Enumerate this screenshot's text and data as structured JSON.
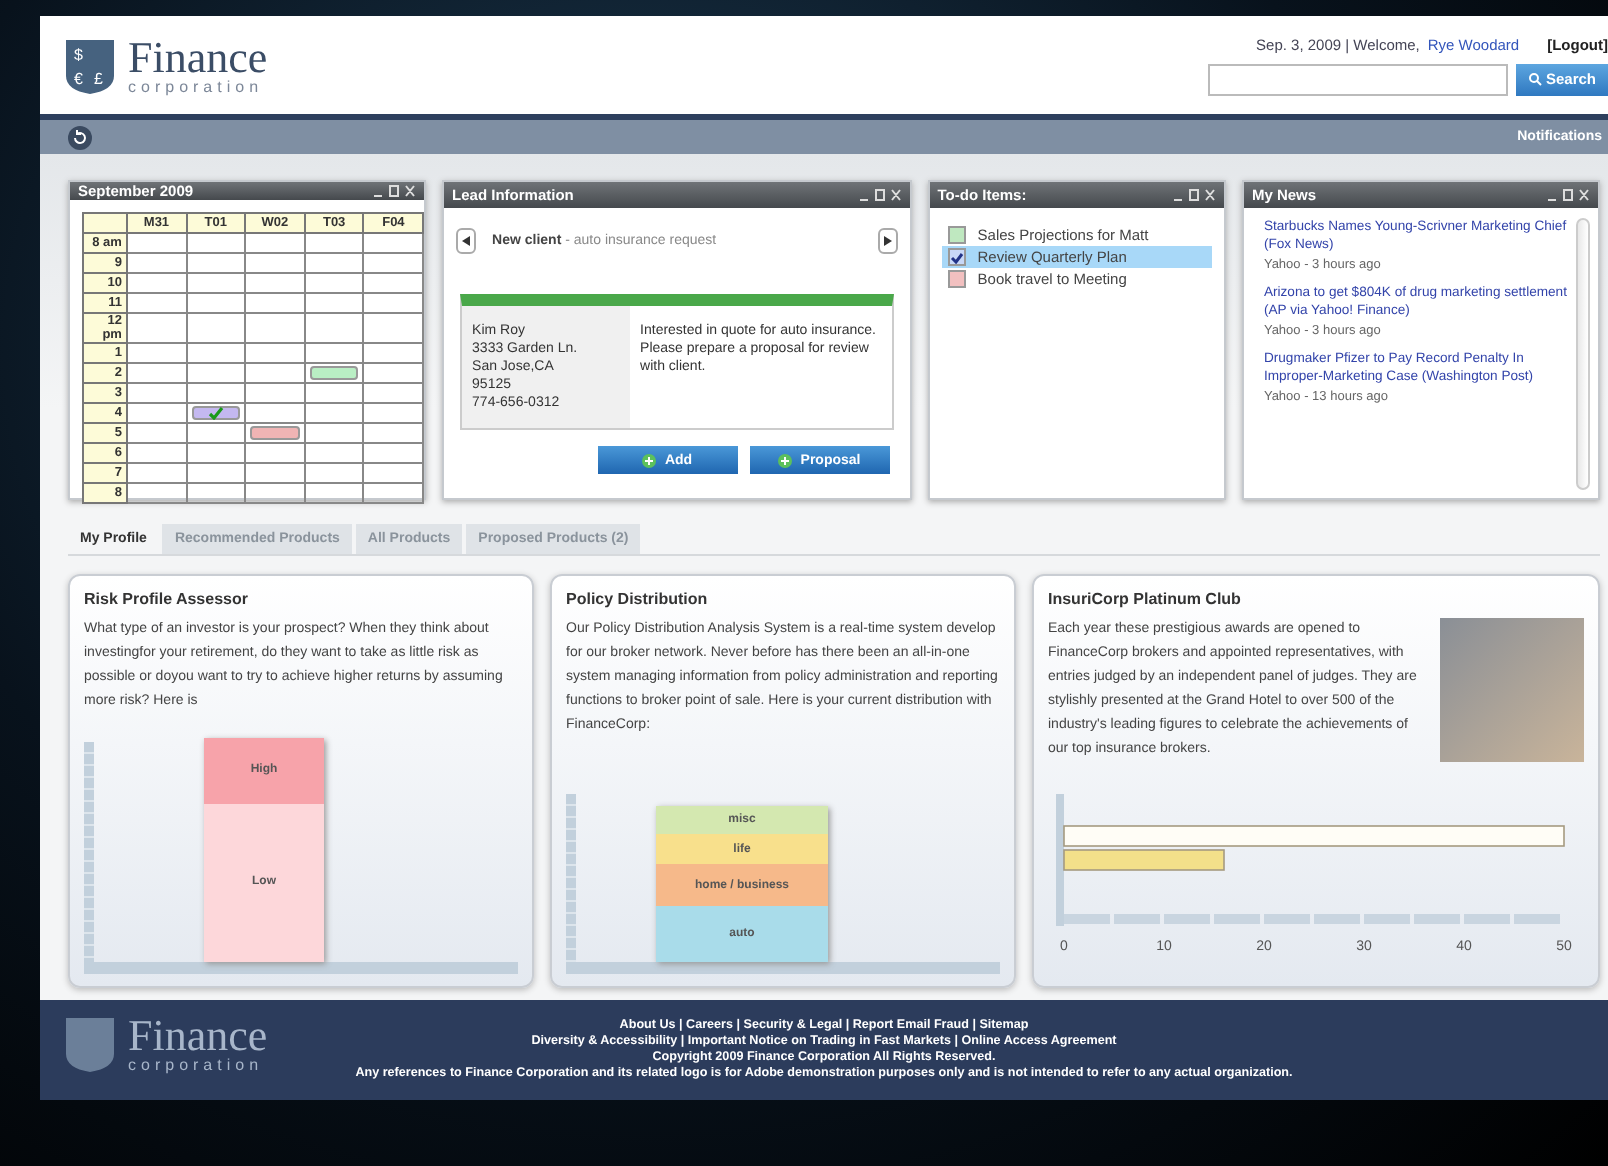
{
  "header": {
    "logo_title": "Finance",
    "logo_subtitle": "corporation",
    "date": "Sep. 3, 2009 | Welcome,",
    "user": "Rye Woodard",
    "logout": "[Logout]",
    "logo_symbols": [
      "$",
      "€",
      "£"
    ],
    "search_button": "Search"
  },
  "nav": {
    "notifications": "Notifications"
  },
  "calendar": {
    "title": "September 2009",
    "days": [
      "M31",
      "T01",
      "W02",
      "T03",
      "F04"
    ],
    "rows": [
      {
        "time": "8 am",
        "cells": [
          {
            "booked": false
          },
          {
            "booked": false
          },
          {
            "booked": false
          },
          {
            "booked": false
          },
          {
            "booked": false
          }
        ]
      },
      {
        "time": "9",
        "cells": [
          {
            "booked": false
          },
          {
            "booked": false
          },
          {
            "booked": false
          },
          {
            "booked": false
          },
          {
            "booked": false
          }
        ]
      },
      {
        "time": "10",
        "cells": [
          {
            "booked": false
          },
          {
            "booked": false
          },
          {
            "booked": false
          },
          {
            "booked": false
          },
          {
            "booked": false
          }
        ]
      },
      {
        "time": "11",
        "cells": [
          {
            "booked": false
          },
          {
            "booked": false
          },
          {
            "booked": false
          },
          {
            "booked": false
          },
          {
            "booked": false
          }
        ]
      },
      {
        "time": "12 pm",
        "cells": [
          {
            "booked": false
          },
          {
            "booked": false
          },
          {
            "booked": false
          },
          {
            "booked": false
          },
          {
            "booked": false
          }
        ]
      },
      {
        "time": "1",
        "cells": [
          {
            "booked": false
          },
          {
            "booked": false
          },
          {
            "booked": false
          },
          {
            "booked": false
          },
          {
            "booked": false
          }
        ]
      },
      {
        "time": "2",
        "cells": [
          {
            "booked": false
          },
          {
            "booked": false
          },
          {
            "booked": false
          },
          {
            "booked": true,
            "color": "#b9efc4",
            "checked": false
          },
          {
            "booked": false
          }
        ]
      },
      {
        "time": "3",
        "cells": [
          {
            "booked": false
          },
          {
            "booked": false
          },
          {
            "booked": false
          },
          {
            "booked": false
          },
          {
            "booked": false
          }
        ]
      },
      {
        "time": "4",
        "cells": [
          {
            "booked": false
          },
          {
            "booked": true,
            "color": "#c4b8f0",
            "checked": true
          },
          {
            "booked": false
          },
          {
            "booked": false
          },
          {
            "booked": false
          }
        ]
      },
      {
        "time": "5",
        "cells": [
          {
            "booked": false
          },
          {
            "booked": false
          },
          {
            "booked": true,
            "color": "#f0b4b4",
            "checked": false
          },
          {
            "booked": false
          },
          {
            "booked": false
          }
        ]
      },
      {
        "time": "6",
        "cells": [
          {
            "booked": false
          },
          {
            "booked": false
          },
          {
            "booked": false
          },
          {
            "booked": false
          },
          {
            "booked": false
          }
        ]
      },
      {
        "time": "7",
        "cells": [
          {
            "booked": false
          },
          {
            "booked": false
          },
          {
            "booked": false
          },
          {
            "booked": false
          },
          {
            "booked": false
          }
        ]
      },
      {
        "time": "8",
        "cells": [
          {
            "booked": false
          },
          {
            "booked": false
          },
          {
            "booked": false
          },
          {
            "booked": false
          },
          {
            "booked": false
          }
        ]
      }
    ]
  },
  "lead": {
    "title": "Lead Information",
    "client": "New client",
    "request": " - auto insurance request",
    "contact": [
      "Kim Roy",
      "3333 Garden Ln.",
      "San Jose,CA",
      "95125",
      "774-656-0312"
    ],
    "note": "Interested in quote for auto insurance. Please prepare a proposal for review with client.",
    "buttons": [
      "Add",
      "Proposal"
    ]
  },
  "todo": {
    "title": "To-do Items:",
    "items": [
      {
        "label": "Sales Projections for Matt",
        "color": "#bfe8c0",
        "checked": false,
        "selected": false
      },
      {
        "label": "Review Quarterly Plan",
        "color": "#c8d8f8",
        "checked": true,
        "selected": true
      },
      {
        "label": "Book travel to Meeting",
        "color": "#f2c0c0",
        "checked": false,
        "selected": false
      }
    ]
  },
  "news": {
    "title": "My News",
    "items": [
      {
        "headline": "Starbucks Names Young-Scrivner Marketing Chief (Fox News)",
        "source": "Yahoo - 3 hours ago"
      },
      {
        "headline": "Arizona to get $804K of drug marketing settlement (AP via Yahoo! Finance)",
        "source": "Yahoo - 3 hours ago"
      },
      {
        "headline": "Drugmaker Pfizer to Pay Record Penalty In Improper-Marketing Case (Washington Post)",
        "source": "Yahoo - 13 hours ago"
      }
    ]
  },
  "tabs": [
    {
      "label": "My Profile",
      "selected": true
    },
    {
      "label": "Recommended Products",
      "selected": false
    },
    {
      "label": "All Products",
      "selected": false
    },
    {
      "label": "Proposed Products (2)",
      "selected": false
    }
  ],
  "cards": [
    {
      "kind": "risk",
      "title": "Risk Profile Assessor",
      "text": "What type of an investor is your prospect? When they think about investingfor your retirement, do they want to take as little risk as possible or doyou want to try to achieve higher returns by assuming more risk? Here is",
      "segments": [
        {
          "label": "High",
          "color": "#f7a3aa"
        },
        {
          "label": "Low",
          "color": "#fdd7da"
        }
      ]
    },
    {
      "kind": "policy",
      "title": "Policy Distribution",
      "text": "Our Policy Distribution Analysis System is a real-time system develop for our broker network. Never before has there been an all-in-one system managing information from policy administration and reporting functions to broker point of sale. Here is your current distribution with FinanceCorp:",
      "segments": [
        {
          "label": "misc",
          "color": "#d4e8b0"
        },
        {
          "label": "life",
          "color": "#f8e08c"
        },
        {
          "label": "home / business",
          "color": "#f6b98a"
        },
        {
          "label": "auto",
          "color": "#a9dcea"
        }
      ]
    },
    {
      "kind": "club",
      "title": "InsuriCorp Platinum Club",
      "text": "Each year these prestigious awards are opened to FinanceCorp brokers and appointed representatives, with entries judged by an independent panel of judges. They are stylishly presented at the Grand Hotel to over 500 of the industry's leading figures to celebrate the achievements of our top insurance brokers.",
      "chart_data": {
        "type": "bar",
        "orientation": "horizontal",
        "categories": [
          null,
          null
        ],
        "values": [
          50,
          16
        ],
        "xlim": [
          0,
          50
        ],
        "xticks": [
          0,
          10,
          20,
          30,
          40,
          50
        ]
      }
    }
  ],
  "footer": {
    "logo_title": "Finance",
    "logo_subtitle": "corporation",
    "lines": [
      "About Us | Careers | Security & Legal | Report Email Fraud | Sitemap",
      "Diversity & Accessibility | Important Notice on Trading in Fast Markets | Online Access Agreement",
      "Copyright 2009 Finance Corporation All Rights Reserved.",
      "Any references to Finance Corporation and its related logo is for Adobe demonstration purposes only and is not intended to refer to any actual organization."
    ]
  }
}
